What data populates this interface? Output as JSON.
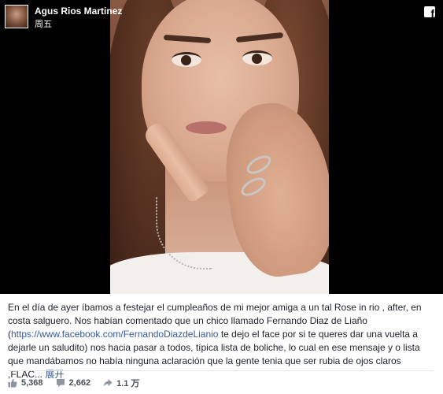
{
  "post": {
    "author": "Agus Rios Martinez",
    "time": "周五",
    "caption_part1": "En el día de ayer íbamos a festejar el cumpleaños de mi mejor amiga a un tal Rose in rio , after, en costa salguero. Nos habían comentado que un chico llamado Fernando Diaz de Liaño (",
    "link": "https://www.facebook.com/FernandoDiazdeLianio",
    "caption_part2": " te dejo el face por si te queres dar una vuelta a dejarle un saludito) nos hacia pasar a todos, típica lista de boliche, lo cual en ese mensaje y o lista que mandábamos no había ninguna aclaración que la gente tenia que ser rubia de ojos claros ,FLAC... ",
    "see_more": "展开"
  },
  "stats": {
    "likes": "5,368",
    "comments": "2,662",
    "shares": "1.1 万"
  },
  "icons": {
    "brand": "facebook-icon",
    "like": "thumbs-up-icon",
    "comment": "comment-icon",
    "share": "share-icon"
  },
  "colors": {
    "media_background": "#000000",
    "link": "#365899",
    "text": "#1d2129",
    "muted": "#4b4f56"
  }
}
